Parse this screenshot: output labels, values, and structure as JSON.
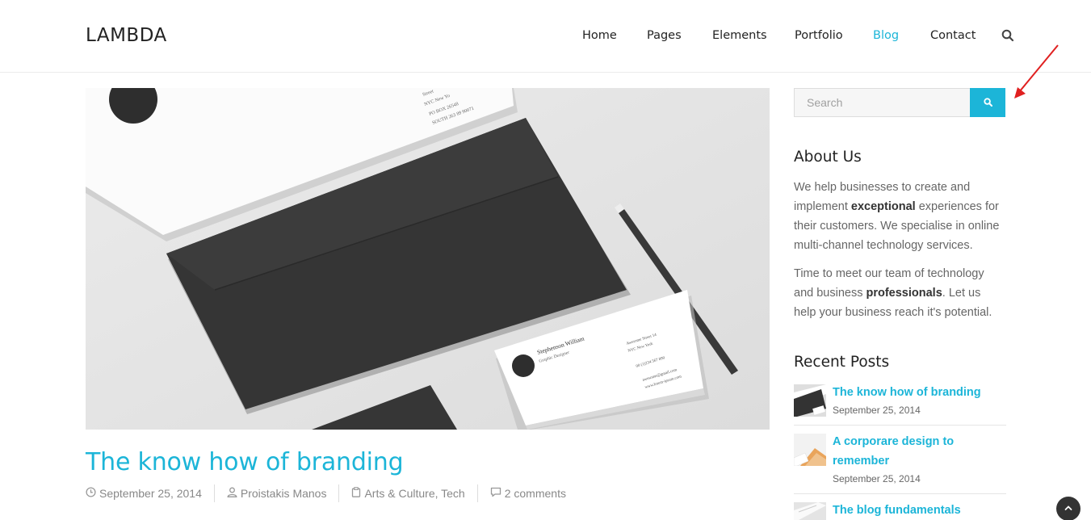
{
  "site": {
    "logo": "LAMBDA"
  },
  "nav": {
    "items": [
      {
        "label": "Home",
        "active": false
      },
      {
        "label": "Pages",
        "active": false
      },
      {
        "label": "Elements",
        "active": false
      },
      {
        "label": "Portfolio",
        "active": false
      },
      {
        "label": "Blog",
        "active": true
      },
      {
        "label": "Contact",
        "active": false
      }
    ],
    "search_icon": "search-icon"
  },
  "post": {
    "title": "The know how of branding",
    "date": "September 25, 2014",
    "author": "Proistakis Manos",
    "categories": "Arts & Culture, Tech",
    "comments": "2 comments",
    "icons": [
      "clock-icon",
      "user-icon",
      "clipboard-icon",
      "comment-icon"
    ]
  },
  "mockup": {
    "card_name": "Stephenson William",
    "card_role": "Graphic Designer",
    "card_address_1": "Awesome Street 14",
    "card_address_2": "NYC New York",
    "card_phone": "00 (1)234 567 890",
    "card_email": "awesome@gmail.com",
    "card_web": "www.lorem-ipsum.com",
    "letter_address_1": "Street",
    "letter_address_2": "NYC New Yo",
    "letter_box": "PO BOX 26548",
    "letter_south": "SOUTH 263 89 90071"
  },
  "sidebar": {
    "search_placeholder": "Search",
    "about_heading": "About Us",
    "about_p1_a": "We help businesses to create and implement ",
    "about_p1_b": "exceptional",
    "about_p1_c": " experiences for their customers. We specialise in online multi-channel technology services.",
    "about_p2_a": "Time to meet our team of technology and business ",
    "about_p2_b": "professionals",
    "about_p2_c": ". Let us help your business reach it's potential.",
    "recent_heading": "Recent Posts",
    "recent_posts": [
      {
        "title": "The know how of branding",
        "date": "September 25, 2014"
      },
      {
        "title": "A corporare design to remember",
        "date": "September 25, 2014"
      },
      {
        "title": "The blog fundamentals",
        "date": ""
      }
    ]
  },
  "colors": {
    "accent": "#1cb5d8",
    "text": "#333333",
    "muted": "#888888",
    "annotation": "#e02020"
  }
}
